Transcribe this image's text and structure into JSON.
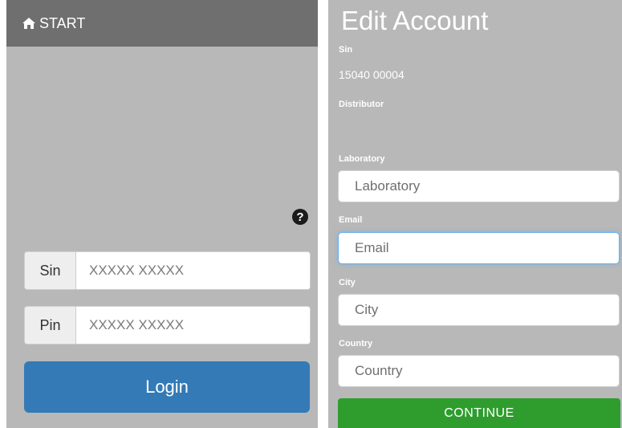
{
  "left": {
    "topbar": {
      "icon": "home-icon",
      "label": "START"
    },
    "help_icon_glyph": "?",
    "sin": {
      "label": "Sin",
      "placeholder": "XXXXX XXXXX"
    },
    "pin": {
      "label": "Pin",
      "placeholder": "XXXXX XXXXX"
    },
    "login_label": "Login"
  },
  "right": {
    "title": "Edit Account",
    "sin_label": "Sin",
    "sin_value": "15040 00004",
    "distributor_label": "Distributor",
    "laboratory": {
      "label": "Laboratory",
      "placeholder": "Laboratory"
    },
    "email": {
      "label": "Email",
      "placeholder": "Email"
    },
    "city": {
      "label": "City",
      "placeholder": "City"
    },
    "country": {
      "label": "Country",
      "placeholder": "Country"
    },
    "continue_label": "CONTINUE"
  },
  "colors": {
    "panel_bg": "#b8b8b8",
    "topbar_bg": "#6f6f6f",
    "login_blue": "#337ab7",
    "continue_green": "#2e9d2e",
    "focus_blue": "#66afe9"
  }
}
